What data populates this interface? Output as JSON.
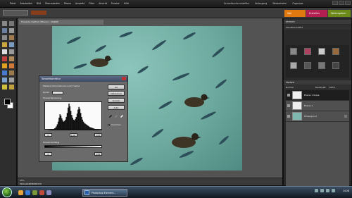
{
  "menu": [
    "Datei",
    "Bearbeiten",
    "Bild",
    "Überarbeiten",
    "Ebene",
    "Auswahl",
    "Filter",
    "Ansicht",
    "Fenster",
    "Hilfe"
  ],
  "top_actions": [
    "Schnellsuche erstellen",
    "Vollzugang",
    "Wiederholen",
    "Organizer"
  ],
  "mode_tabs": {
    "edit": "Voll",
    "create": "Erstellen",
    "share": "Weitergeben"
  },
  "document": {
    "tab": "Holzente-Haifisch (Ebene 1, RGB/8)",
    "zoom": "25%",
    "hint": "PROGRAMMBEREICH"
  },
  "levels": {
    "title": "Tonwertkorrektur",
    "info": "Weitere Informationen zum Thema",
    "channel_label": "Kanal:",
    "channel_value": "RGB",
    "input_label": "Tonwertspreizung",
    "input_values": [
      "0",
      "1,00",
      "255"
    ],
    "output_label": "Tonwertumfang",
    "output_values": [
      "0",
      "255"
    ],
    "buttons": [
      "OK",
      "Abbrechen",
      "Zurück",
      "Auto"
    ],
    "preview_label": "Vorschau",
    "histogram": [
      0,
      0,
      0,
      1,
      1,
      2,
      2,
      3,
      3,
      4,
      6,
      8,
      12,
      18,
      26,
      38,
      48,
      44,
      36,
      30,
      26,
      28,
      32,
      40,
      52,
      68,
      80,
      72,
      58,
      46,
      38,
      32,
      30,
      34,
      40,
      50,
      62,
      70,
      64,
      52,
      40,
      32,
      26,
      22,
      20,
      18,
      16,
      14,
      12,
      10,
      9,
      8,
      7,
      6,
      5,
      4,
      3,
      3,
      2,
      2,
      1,
      1,
      1,
      0
    ]
  },
  "right_panel": {
    "header": "EFFEKTE",
    "effects_tab": "Alle Ebenenstile",
    "layers_header": "EBENEN",
    "blend_mode": "Normal",
    "opacity_label": "Deckkraft:",
    "opacity_value": "100%",
    "layers": [
      {
        "name": "Ebene 1 Kopie",
        "active": true
      },
      {
        "name": "Ebene 1",
        "active": false
      },
      {
        "name": "Hintergrund",
        "active": false
      }
    ]
  },
  "taskbar": {
    "task": "Photoshop Element...",
    "time": "14:28"
  },
  "colors": {
    "accent_edit": "#e07a10",
    "accent_create": "#b31f50",
    "accent_share": "#6b8a1a"
  }
}
